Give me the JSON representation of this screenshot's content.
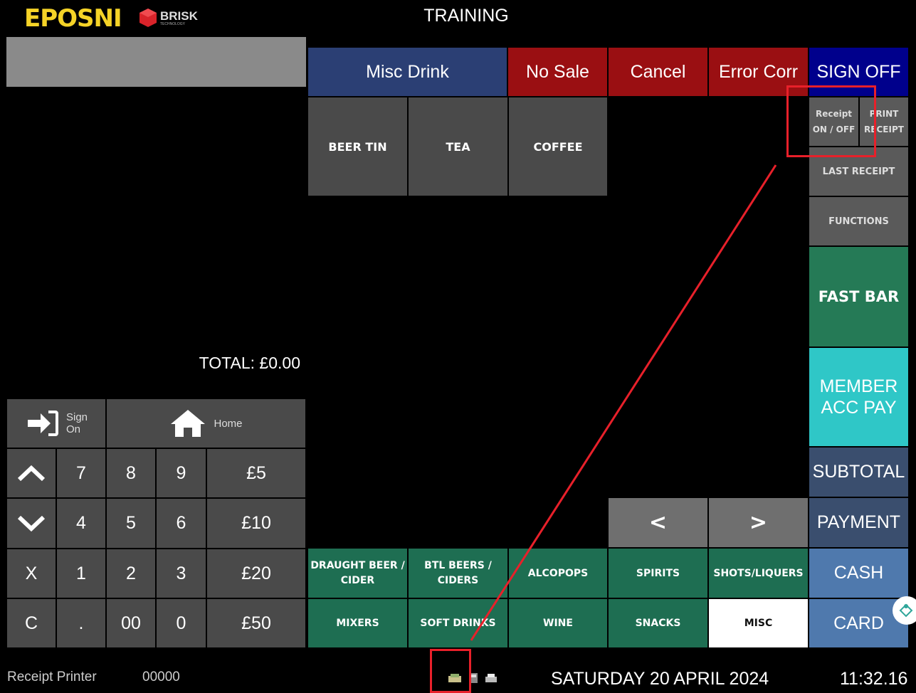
{
  "header": {
    "logo_text": "EPOSNI",
    "brand_text": "BRISK",
    "brand_sub": "TECHNOLOGY",
    "mode_title": "TRAINING"
  },
  "order": {
    "total_label": "TOTAL: £0.00"
  },
  "top_buttons": {
    "misc_drink": "Misc Drink",
    "no_sale": "No Sale",
    "cancel": "Cancel",
    "error_corr": "Error Corr",
    "sign_off": "SIGN OFF"
  },
  "products": [
    "BEER TIN",
    "TEA",
    "COFFEE"
  ],
  "right_panel": {
    "receipt_on_off": [
      "Receipt",
      "ON / OFF"
    ],
    "print_receipt": [
      "PRINT",
      "RECEIPT"
    ],
    "last_receipt": "LAST RECEIPT",
    "functions": "FUNCTIONS",
    "fast_bar": "FAST BAR",
    "member_acc_pay": [
      "MEMBER",
      "ACC PAY"
    ],
    "subtotal": "SUBTOTAL",
    "payment": "PAYMENT",
    "cash": "CASH",
    "card": "CARD"
  },
  "nav": {
    "prev": "<",
    "next": ">"
  },
  "categories": {
    "row1": [
      [
        "DRAUGHT BEER /",
        "CIDER"
      ],
      [
        "BTL BEERS /",
        "CIDERS"
      ],
      "ALCOPOPS",
      "SPIRITS",
      "SHOTS/LIQUERS"
    ],
    "row2": [
      "MIXERS",
      "SOFT DRINKS",
      "WINE",
      "SNACKS",
      "MISC"
    ]
  },
  "keypad": {
    "sign_on": [
      "Sign",
      "On"
    ],
    "home": "Home",
    "row1": [
      "7",
      "8",
      "9",
      "£5"
    ],
    "row2": [
      "4",
      "5",
      "6",
      "£10"
    ],
    "row3": [
      "X",
      "1",
      "2",
      "3",
      "£20"
    ],
    "row4": [
      "C",
      ".",
      "00",
      "0",
      "£50"
    ]
  },
  "status": {
    "printer": "Receipt Printer",
    "code": "00000",
    "date": "SATURDAY 20 APRIL 2024",
    "time": "11:32.16"
  },
  "colors": {
    "annotation": "#e8202a",
    "accent_yellow": "#f5d327"
  }
}
